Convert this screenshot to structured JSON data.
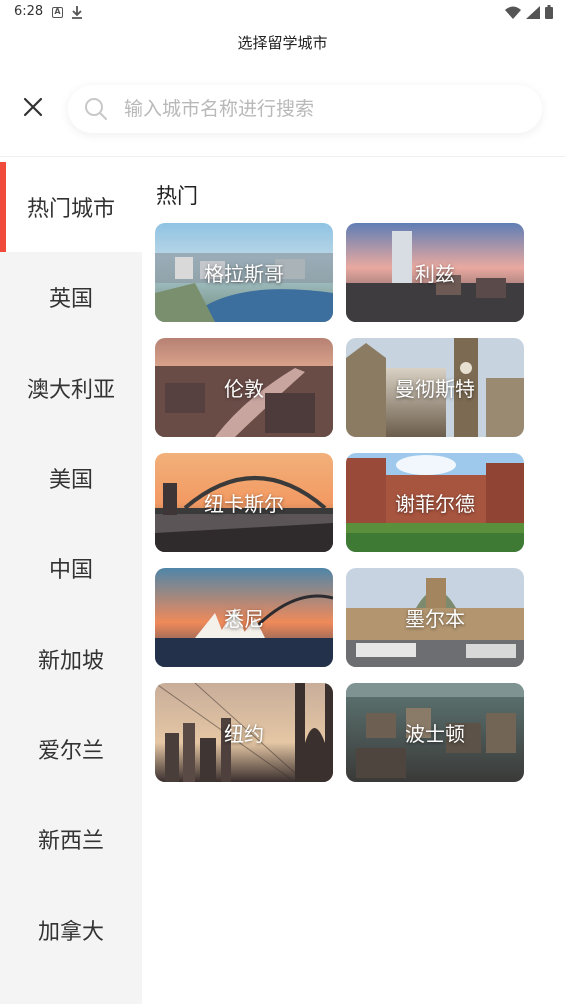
{
  "status_bar": {
    "time": "6:28"
  },
  "header": {
    "title": "选择留学城市"
  },
  "search": {
    "placeholder": "输入城市名称进行搜索",
    "value": ""
  },
  "sidebar": {
    "items": [
      {
        "label": "热门城市",
        "active": true
      },
      {
        "label": "英国"
      },
      {
        "label": "澳大利亚"
      },
      {
        "label": "美国"
      },
      {
        "label": "中国"
      },
      {
        "label": "新加坡"
      },
      {
        "label": "爱尔兰"
      },
      {
        "label": "新西兰"
      },
      {
        "label": "加拿大"
      }
    ]
  },
  "main": {
    "section_title": "热门",
    "cities": [
      {
        "name": "格拉斯哥"
      },
      {
        "name": "利兹"
      },
      {
        "name": "伦敦"
      },
      {
        "name": "曼彻斯特"
      },
      {
        "name": "纽卡斯尔"
      },
      {
        "name": "谢菲尔德"
      },
      {
        "name": "悉尼"
      },
      {
        "name": "墨尔本"
      },
      {
        "name": "纽约"
      },
      {
        "name": "波士顿"
      }
    ]
  },
  "colors": {
    "accent": "#f04a3a",
    "sidebar_bg": "#f4f4f4"
  }
}
